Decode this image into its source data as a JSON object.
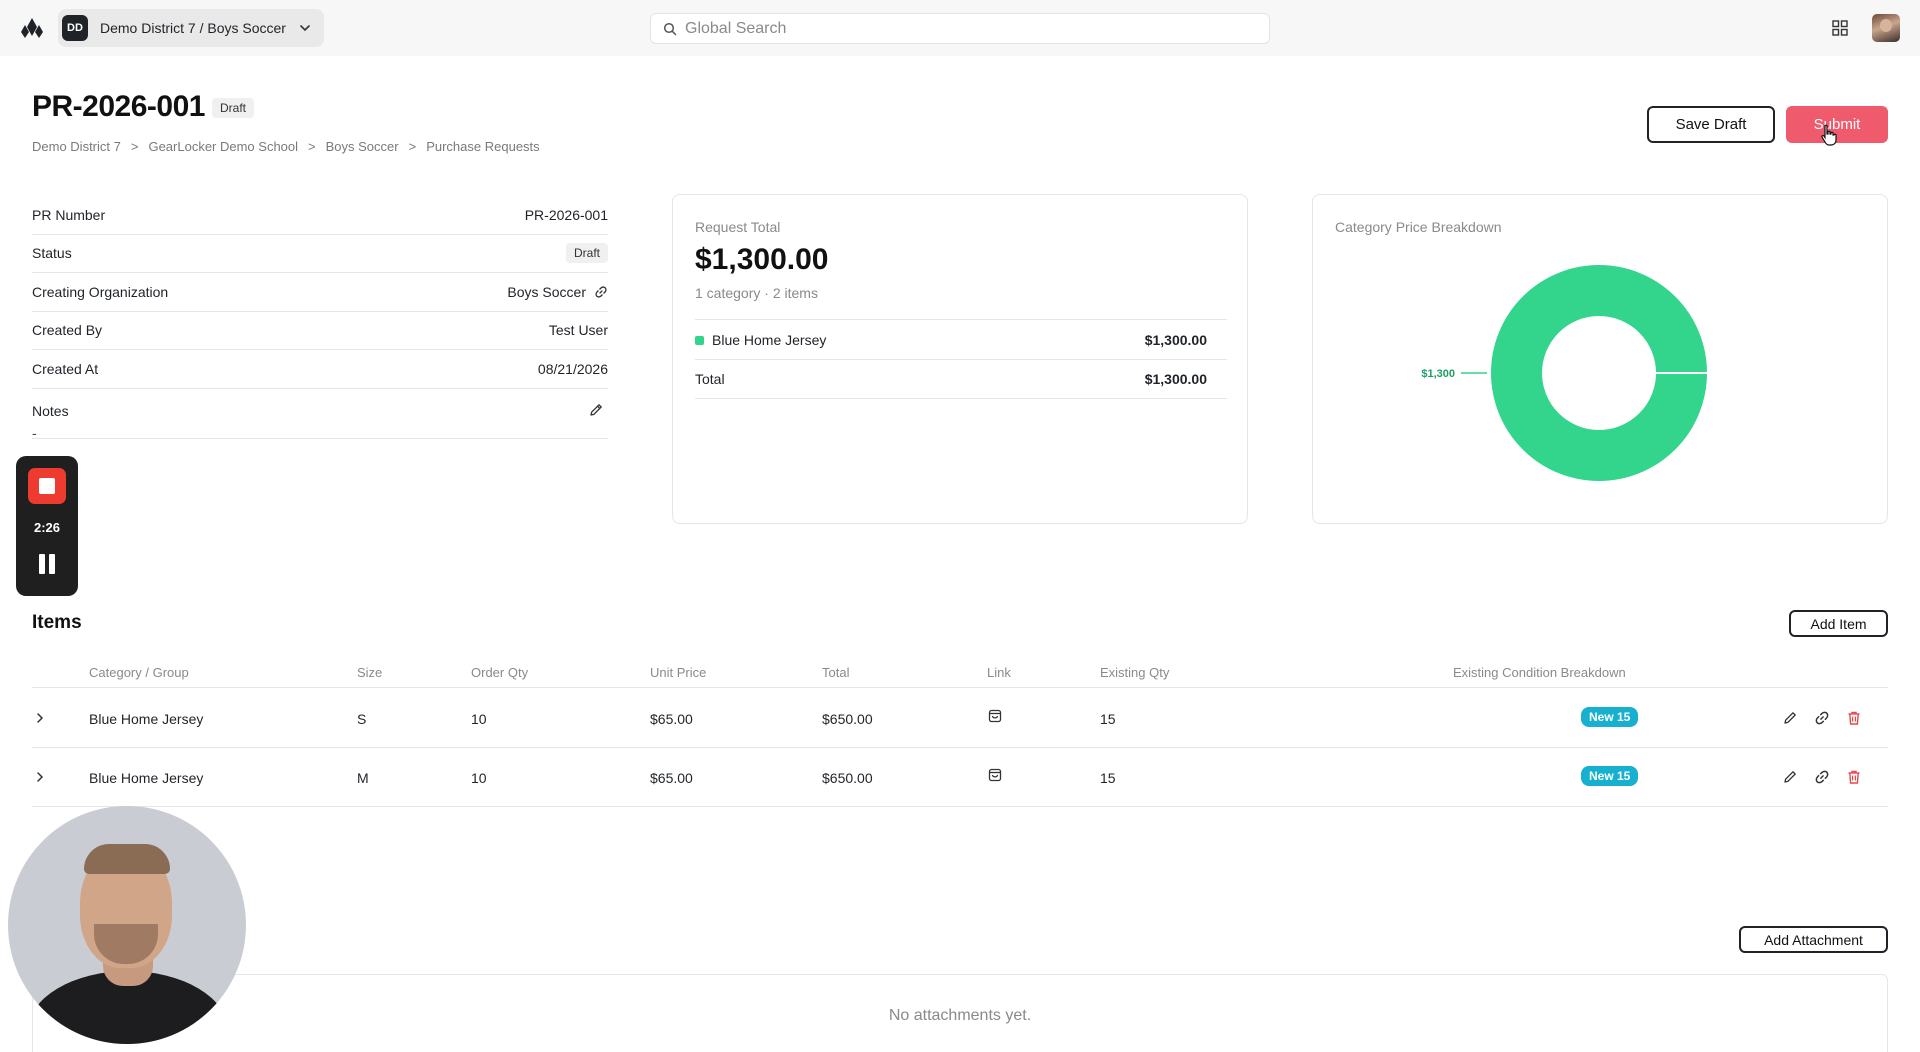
{
  "topbar": {
    "org_initials": "DD",
    "org_name": "Demo District 7 / Boys Soccer",
    "search_placeholder": "Global Search"
  },
  "header": {
    "title": "PR-2026-001",
    "status_badge": "Draft",
    "breadcrumb": [
      "Demo District 7",
      "GearLocker Demo School",
      "Boys Soccer",
      "Purchase Requests"
    ],
    "breadcrumb_sep": ">",
    "save_label": "Save Draft",
    "submit_label": "Submit"
  },
  "details": {
    "rows": [
      {
        "label": "PR Number",
        "value": "PR-2026-001"
      },
      {
        "label": "Status",
        "value": "Draft"
      },
      {
        "label": "Creating Organization",
        "value": "Boys Soccer"
      },
      {
        "label": "Created By",
        "value": "Test User"
      },
      {
        "label": "Created At",
        "value": "08/21/2026"
      }
    ],
    "notes_label": "Notes",
    "notes_value": "-"
  },
  "request_total": {
    "label": "Request Total",
    "amount": "$1,300.00",
    "summary": "1 category · 2 items",
    "lines": [
      {
        "name": "Blue Home Jersey",
        "amount": "$1,300.00",
        "color": "#33d48b"
      }
    ],
    "total_label": "Total",
    "total_amount": "$1,300.00"
  },
  "chart_data": {
    "type": "pie",
    "title": "Category Price Breakdown",
    "categories": [
      "Blue Home Jersey"
    ],
    "values": [
      1300
    ],
    "data_labels": [
      "$1,300"
    ],
    "colors": [
      "#33d48b"
    ],
    "donut": true
  },
  "recording": {
    "time": "2:26"
  },
  "items": {
    "title": "Items",
    "add_label": "Add Item",
    "columns": [
      "Category / Group",
      "Size",
      "Order Qty",
      "Unit Price",
      "Total",
      "Link",
      "Existing Qty",
      "Existing Condition Breakdown"
    ],
    "rows": [
      {
        "category": "Blue Home Jersey",
        "size": "S",
        "qty": "10",
        "unit_price": "$65.00",
        "total": "$650.00",
        "existing_qty": "15",
        "condition": "New 15"
      },
      {
        "category": "Blue Home Jersey",
        "size": "M",
        "qty": "10",
        "unit_price": "$65.00",
        "total": "$650.00",
        "existing_qty": "15",
        "condition": "New 15"
      }
    ]
  },
  "attachments": {
    "add_label": "Add Attachment",
    "empty_text": "No attachments yet."
  },
  "colors": {
    "accent": "#ef5b6d",
    "chart_green": "#33d48b",
    "badge_teal": "#17b1cf",
    "danger": "#e5484d"
  },
  "icons": [
    "logo-icon",
    "chevron-down-icon",
    "search-icon",
    "apps-grid-icon",
    "external-link-icon",
    "pencil-icon",
    "shopping-bag-icon",
    "link-icon",
    "trash-icon",
    "chevron-right-icon",
    "stop-icon",
    "pause-icon"
  ]
}
